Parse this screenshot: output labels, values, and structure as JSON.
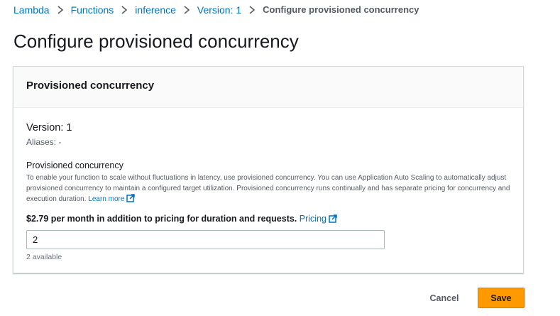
{
  "breadcrumb": {
    "items": [
      "Lambda",
      "Functions",
      "inference",
      "Version: 1"
    ],
    "current": "Configure provisioned concurrency"
  },
  "page_title": "Configure provisioned concurrency",
  "panel": {
    "title": "Provisioned concurrency",
    "version": "Version: 1",
    "aliases": "Aliases: -",
    "field_label": "Provisioned concurrency",
    "description": "To enable your function to scale without fluctuations in latency, use provisioned concurrency. You can use Application Auto Scaling to automatically adjust provisioned concurrency to maintain a configured target utilization. Provisioned concurrency runs continually and has separate pricing for concurrency and execution duration.",
    "learn_more": "Learn more",
    "price_text": "$2.79 per month in addition to pricing for duration and requests.",
    "pricing_link": "Pricing",
    "input_value": "2",
    "available": "2 available"
  },
  "actions": {
    "cancel": "Cancel",
    "save": "Save"
  },
  "colors": {
    "link": "#0073bb",
    "primary_button": "#ff9900",
    "border": "#d5dbdb"
  },
  "icons": {
    "breadcrumb_separator": "chevron-right-icon",
    "external": "external-link-icon"
  }
}
